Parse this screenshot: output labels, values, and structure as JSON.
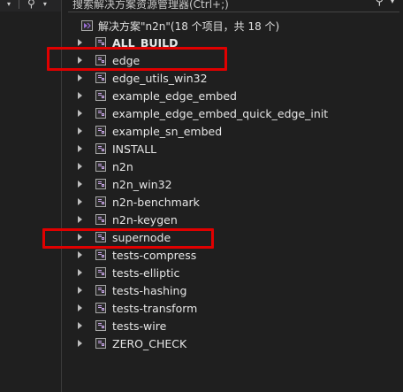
{
  "left_toolbar": {
    "items": [
      "search-icon",
      "dropdown-icon"
    ]
  },
  "search": {
    "placeholder": "搜索解决方案资源管理器(Ctrl+;)"
  },
  "solution": {
    "label": "解决方案\"n2n\"(18 个项目，共 18 个)"
  },
  "projects": [
    {
      "label": "ALL_BUILD"
    },
    {
      "label": "edge"
    },
    {
      "label": "edge_utils_win32"
    },
    {
      "label": "example_edge_embed"
    },
    {
      "label": "example_edge_embed_quick_edge_init"
    },
    {
      "label": "example_sn_embed"
    },
    {
      "label": "INSTALL"
    },
    {
      "label": "n2n"
    },
    {
      "label": "n2n_win32"
    },
    {
      "label": "n2n-benchmark"
    },
    {
      "label": "n2n-keygen"
    },
    {
      "label": "supernode"
    },
    {
      "label": "tests-compress"
    },
    {
      "label": "tests-elliptic"
    },
    {
      "label": "tests-hashing"
    },
    {
      "label": "tests-transform"
    },
    {
      "label": "tests-wire"
    },
    {
      "label": "ZERO_CHECK"
    }
  ],
  "colors": {
    "highlight": "#e00000",
    "background": "#1f1f1f"
  }
}
